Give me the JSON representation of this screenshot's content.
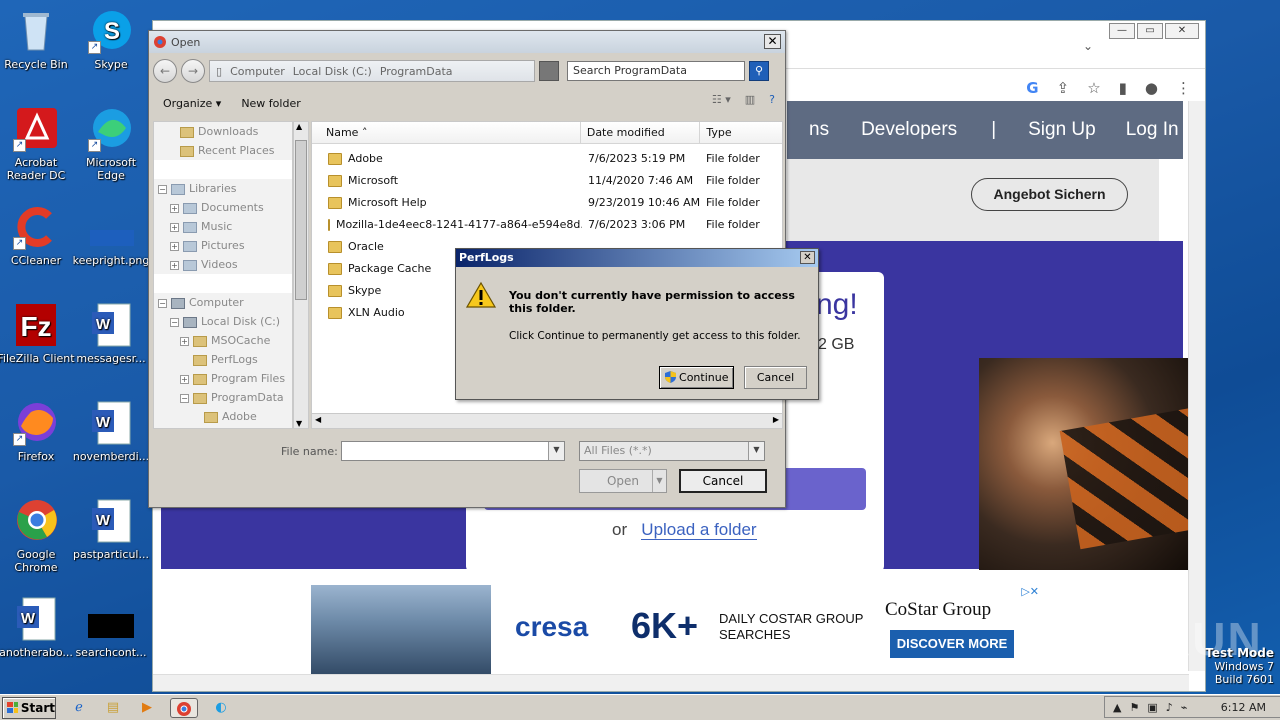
{
  "desktop_icons": [
    {
      "label": "Recycle Bin",
      "icon": "recycle-bin-icon"
    },
    {
      "label": "Skype",
      "icon": "skype-icon"
    },
    {
      "label": "Acrobat Reader DC",
      "icon": "acrobat-icon"
    },
    {
      "label": "Microsoft Edge",
      "icon": "edge-icon"
    },
    {
      "label": "CCleaner",
      "icon": "ccleaner-icon"
    },
    {
      "label": "keepright.png",
      "icon": "png-file-icon"
    },
    {
      "label": "FileZilla Client",
      "icon": "filezilla-icon"
    },
    {
      "label": "messagesr...",
      "icon": "word-doc-icon"
    },
    {
      "label": "Firefox",
      "icon": "firefox-icon"
    },
    {
      "label": "novemberdi...",
      "icon": "word-doc-icon"
    },
    {
      "label": "Google Chrome",
      "icon": "chrome-icon"
    },
    {
      "label": "pastparticul...",
      "icon": "word-doc-icon"
    },
    {
      "label": "anotherabo...",
      "icon": "word-doc-icon"
    },
    {
      "label": "searchcont...",
      "icon": "black-file-icon"
    }
  ],
  "browser": {
    "nav": [
      "ns",
      "Developers",
      "|",
      "Sign Up",
      "Log In"
    ],
    "cta": "Angebot Sichern",
    "hero_fragment": "ng!",
    "size_fragment": "2 GB",
    "upload_or": "or",
    "upload_link": "Upload a folder",
    "ad": {
      "brand": "cresa",
      "big": "6K+",
      "line1": "DAILY COSTAR GROUP",
      "line2": "SEARCHES",
      "costar": "CoStar Group",
      "button": "DISCOVER MORE"
    }
  },
  "open_dialog": {
    "title": "Open",
    "breadcrumb": [
      "Computer",
      "Local Disk (C:)",
      "ProgramData"
    ],
    "search_placeholder": "Search ProgramData",
    "toolbar": {
      "organize": "Organize",
      "new_folder": "New folder"
    },
    "nav_pane": [
      {
        "label": "Downloads",
        "indent": 1
      },
      {
        "label": "Recent Places",
        "indent": 1
      },
      {
        "label": "Libraries",
        "indent": 0
      },
      {
        "label": "Documents",
        "indent": 1
      },
      {
        "label": "Music",
        "indent": 1
      },
      {
        "label": "Pictures",
        "indent": 1
      },
      {
        "label": "Videos",
        "indent": 1
      },
      {
        "label": "Computer",
        "indent": 0
      },
      {
        "label": "Local Disk (C:)",
        "indent": 1
      },
      {
        "label": "MSOCache",
        "indent": 2
      },
      {
        "label": "PerfLogs",
        "indent": 2
      },
      {
        "label": "Program Files",
        "indent": 2
      },
      {
        "label": "ProgramData",
        "indent": 2
      },
      {
        "label": "Adobe",
        "indent": 3
      }
    ],
    "columns": [
      "Name",
      "Date modified",
      "Type"
    ],
    "files": [
      {
        "name": "Adobe",
        "date": "7/6/2023 5:19 PM",
        "type": "File folder"
      },
      {
        "name": "Microsoft",
        "date": "11/4/2020 7:46 AM",
        "type": "File folder"
      },
      {
        "name": "Microsoft Help",
        "date": "9/23/2019 10:46 AM",
        "type": "File folder"
      },
      {
        "name": "Mozilla-1de4eec8-1241-4177-a864-e594e8d...",
        "date": "7/6/2023 3:06 PM",
        "type": "File folder"
      },
      {
        "name": "Oracle",
        "date": "",
        "type": ""
      },
      {
        "name": "Package Cache",
        "date": "",
        "type": ""
      },
      {
        "name": "Skype",
        "date": "",
        "type": ""
      },
      {
        "name": "XLN Audio",
        "date": "",
        "type": ""
      }
    ],
    "file_name_label": "File name:",
    "file_type": "All Files (*.*)",
    "open_label": "Open",
    "cancel_label": "Cancel"
  },
  "message_box": {
    "title": "PerfLogs",
    "heading": "You don't currently have permission to access this folder.",
    "body": "Click Continue to permanently get access to this folder.",
    "continue_label": "Continue",
    "cancel_label": "Cancel"
  },
  "taskbar": {
    "start": "Start",
    "clock": "6:12 AM"
  },
  "watermark": "ANY RUN",
  "windows_info": {
    "line1": "Test Mode",
    "line2": "Windows 7",
    "line3": "Build 7601"
  }
}
